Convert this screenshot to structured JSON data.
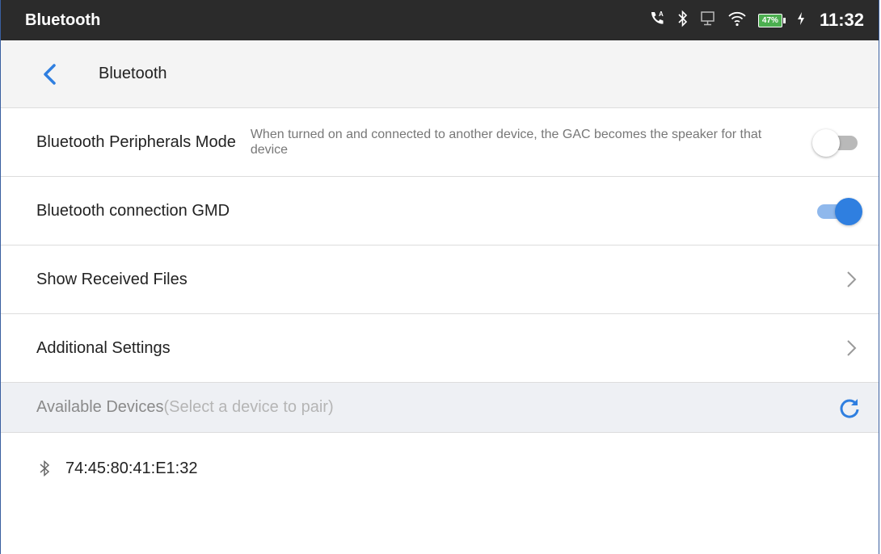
{
  "status_bar": {
    "title": "Bluetooth",
    "battery_percent": "47%",
    "time": "11:32",
    "icons": [
      "call-forward-icon",
      "bluetooth-icon",
      "monitor-icon",
      "wifi-icon",
      "battery-icon",
      "charging-icon"
    ]
  },
  "header": {
    "back_icon": "chevron-left-icon",
    "title": "Bluetooth"
  },
  "settings": {
    "peripherals_mode": {
      "label": "Bluetooth Peripherals Mode",
      "description": "When turned on and connected to another device, the GAC becomes the speaker for that device",
      "enabled": false
    },
    "connection_gmd": {
      "label": "Bluetooth connection GMD",
      "enabled": true
    },
    "received_files": {
      "label": "Show Received Files"
    },
    "additional_settings": {
      "label": "Additional Settings"
    }
  },
  "available_devices": {
    "title": "Available Devices",
    "hint": "(Select a device to pair)",
    "devices": [
      {
        "name": "74:45:80:41:E1:32",
        "icon": "bluetooth-icon"
      }
    ]
  },
  "colors": {
    "accent": "#2f7fe0",
    "status_bar_bg": "#2b2b2b",
    "battery": "#4caf50",
    "section_bg": "#eef0f4"
  }
}
